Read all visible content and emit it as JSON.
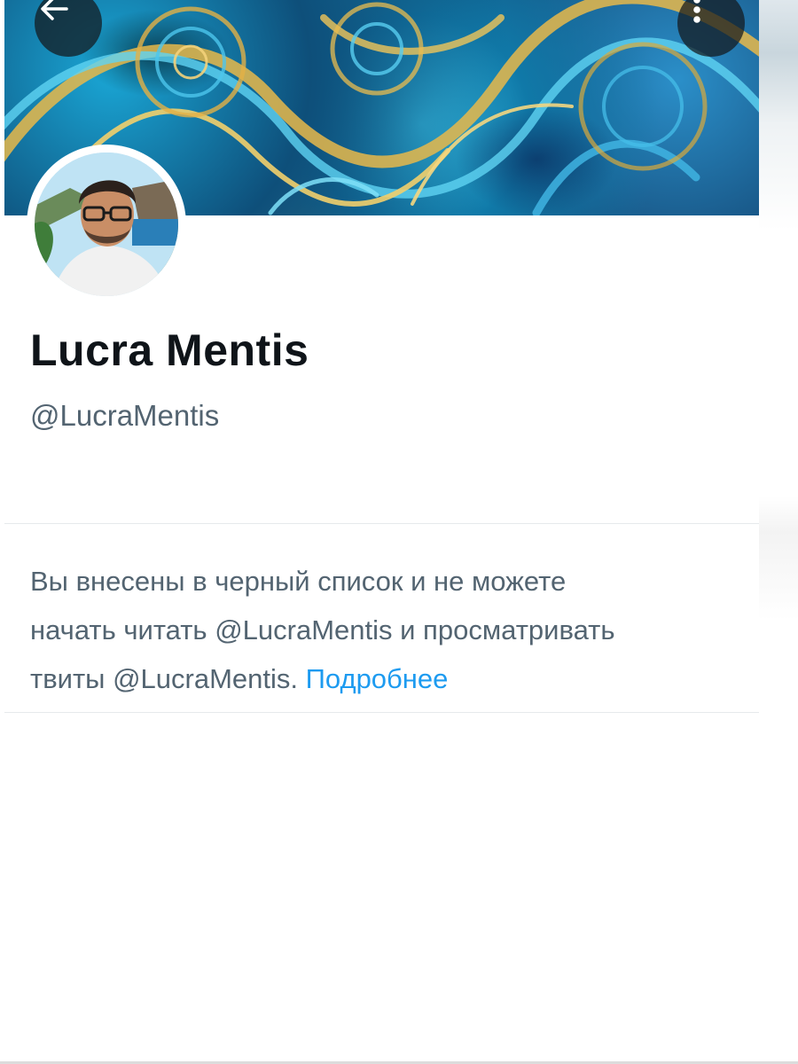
{
  "header": {
    "back_icon": "arrow-left-icon",
    "more_icon": "more-vertical-icon"
  },
  "profile": {
    "display_name": "Lucra Mentis",
    "handle": "@LucraMentis"
  },
  "blocked_notice": {
    "line1": "Вы внесены в черный список и не можете",
    "line2": "начать читать @LucraMentis и просматривать",
    "line3_prefix": "твиты @LucraMentis.",
    "learn_more": "Подробнее"
  },
  "colors": {
    "name": "#0f1419",
    "secondary_text": "#536471",
    "link": "#1d9bf0",
    "divider": "#e6e9ec"
  }
}
